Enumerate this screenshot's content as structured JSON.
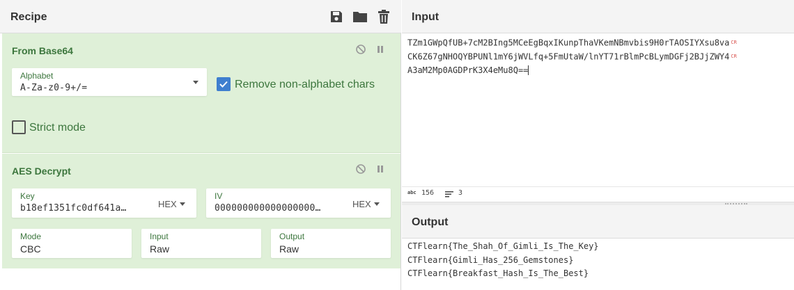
{
  "recipe": {
    "title": "Recipe",
    "save_icon": "save-icon",
    "load_icon": "folder-icon",
    "clear_icon": "trash-icon"
  },
  "operations": [
    {
      "name": "From Base64",
      "alphabet_label": "Alphabet",
      "alphabet_value": "A-Za-z0-9+/=",
      "remove_nonalpha_label": "Remove non-alphabet chars",
      "remove_nonalpha_checked": true,
      "strict_mode_label": "Strict mode",
      "strict_mode_checked": false
    },
    {
      "name": "AES Decrypt",
      "key_label": "Key",
      "key_value": "b18ef1351fc0df641a…",
      "key_format": "HEX",
      "iv_label": "IV",
      "iv_value": "000000000000000000…",
      "iv_format": "HEX",
      "mode_label": "Mode",
      "mode_value": "CBC",
      "input_label": "Input",
      "input_value": "Raw",
      "output_label": "Output",
      "output_value": "Raw"
    }
  ],
  "input": {
    "title": "Input",
    "lines": [
      "TZm1GWpQfUB+7cM2BIng5MCeEgBqxIKunpThaVKemNBmvbis9H0rTAOSIYXsu8va",
      "CK6Z67gNHOQYBPUNl1mY6jWVLfq+5FmUtaW/lnYT71rBlmPcBLymDGFj2BJjZWY4",
      "A3aM2Mp0AGDPrK3X4eMu8Q=="
    ],
    "line_break_marker": "CR",
    "status_length_label": "abc",
    "status_length": "156",
    "status_lines": "3"
  },
  "output": {
    "title": "Output",
    "lines": [
      "CTFlearn{The_Shah_Of_Gimli_Is_The_Key}",
      "CTFlearn{Gimli_Has_256_Gemstones}",
      "CTFlearn{Breakfast_Hash_Is_The_Best}"
    ]
  },
  "colors": {
    "op_background": "#dff0d8",
    "op_text": "#3c763d",
    "checkbox_accent": "#3f7fcf",
    "line_break_marker": "#d9534f"
  }
}
